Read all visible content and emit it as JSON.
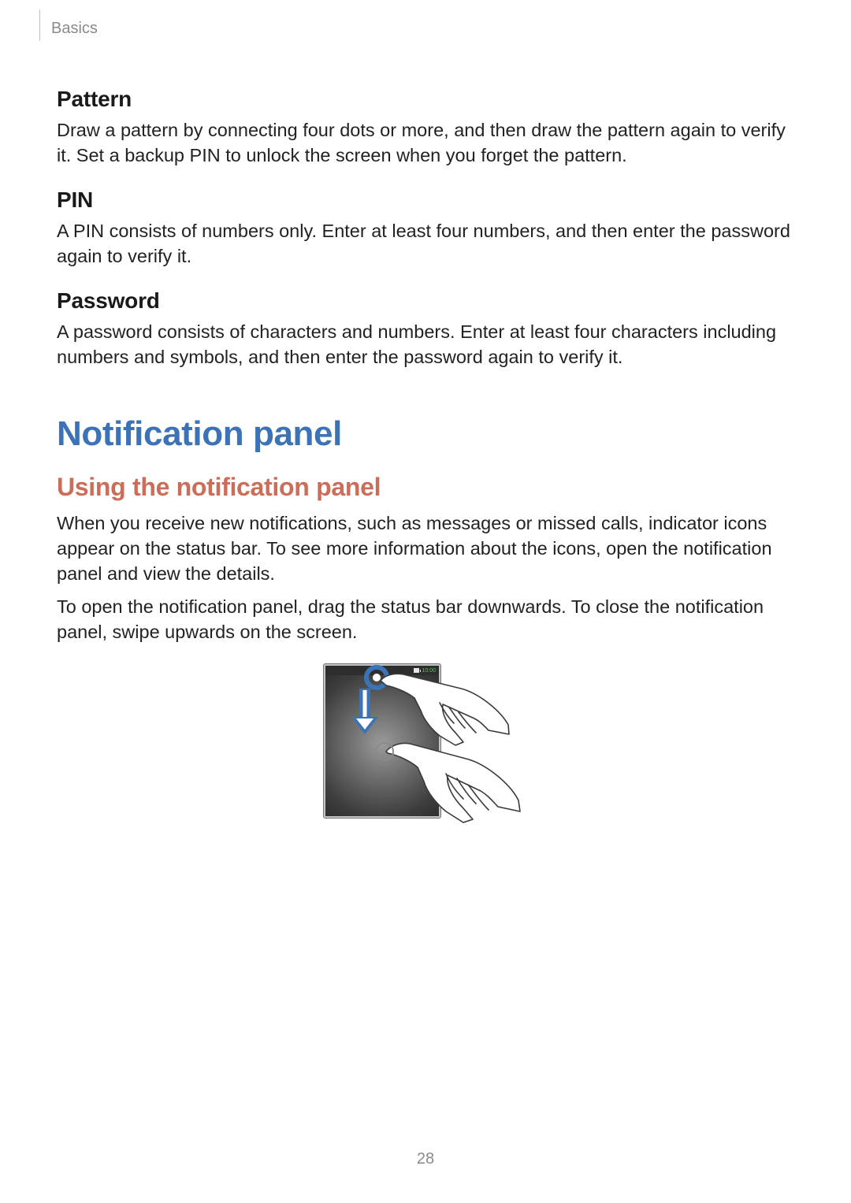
{
  "header": {
    "section": "Basics"
  },
  "sections": {
    "pattern": {
      "title": "Pattern",
      "body": "Draw a pattern by connecting four dots or more, and then draw the pattern again to verify it. Set a backup PIN to unlock the screen when you forget the pattern."
    },
    "pin": {
      "title": "PIN",
      "body": "A PIN consists of numbers only. Enter at least four numbers, and then enter the password again to verify it."
    },
    "password": {
      "title": "Password",
      "body": "A password consists of characters and numbers. Enter at least four characters including numbers and symbols, and then enter the password again to verify it."
    },
    "notif_panel": {
      "title": "Notification panel",
      "subtitle": "Using the notification panel",
      "p1": "When you receive new notifications, such as messages or missed calls, indicator icons appear on the status bar. To see more information about the icons, open the notification panel and view the details.",
      "p2": "To open the notification panel, drag the status bar downwards. To close the notification panel, swipe upwards on the screen."
    }
  },
  "figure": {
    "statusbar_time": "10:00"
  },
  "page_number": "28"
}
